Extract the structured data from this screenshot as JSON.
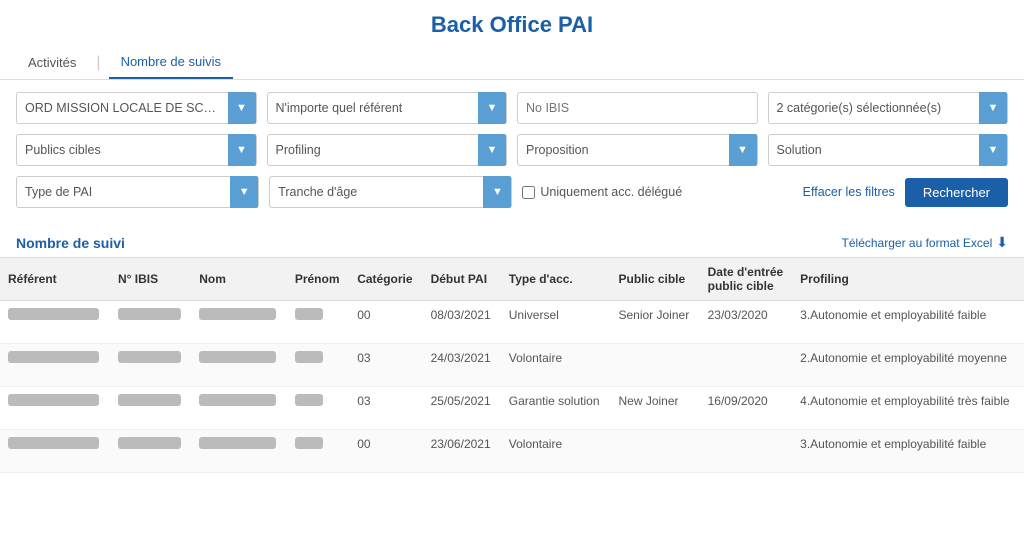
{
  "page": {
    "title": "Back Office PAI"
  },
  "tabs": [
    {
      "id": "activites",
      "label": "Activités",
      "active": false
    },
    {
      "id": "nombre-suivis",
      "label": "Nombre de suivis",
      "active": true
    }
  ],
  "filters": {
    "row1": [
      {
        "id": "mission-locale",
        "label": "ORD MISSION LOCALE DE SCHA...",
        "type": "select"
      },
      {
        "id": "referent",
        "label": "N'importe quel référent",
        "type": "select"
      },
      {
        "id": "ibis",
        "label": "No IBIS",
        "type": "input"
      },
      {
        "id": "categories",
        "label": "2 catégorie(s) sélectionnée(s)",
        "type": "select"
      }
    ],
    "row2": [
      {
        "id": "publics-cibles",
        "label": "Publics cibles",
        "type": "select"
      },
      {
        "id": "profiling",
        "label": "Profiling",
        "type": "select"
      },
      {
        "id": "proposition",
        "label": "Proposition",
        "type": "select"
      },
      {
        "id": "solution",
        "label": "Solution",
        "type": "select"
      }
    ],
    "row3": [
      {
        "id": "type-pai",
        "label": "Type de PAI",
        "type": "select"
      },
      {
        "id": "tranche-age",
        "label": "Tranche d'âge",
        "type": "select"
      },
      {
        "id": "uniquement-acc-delegue",
        "label": "Uniquement acc. délégué",
        "type": "checkbox"
      }
    ],
    "clear_label": "Effacer les filtres",
    "search_label": "Rechercher"
  },
  "section": {
    "title": "Nombre de suivi",
    "excel_label": "Télécharger au format Excel"
  },
  "table": {
    "columns": [
      {
        "id": "referent",
        "label": "Référent"
      },
      {
        "id": "ibis",
        "label": "N° IBIS"
      },
      {
        "id": "nom",
        "label": "Nom"
      },
      {
        "id": "prenom",
        "label": "Prénom"
      },
      {
        "id": "categorie",
        "label": "Catégorie"
      },
      {
        "id": "debut-pai",
        "label": "Début PAI"
      },
      {
        "id": "type-acc",
        "label": "Type d'acc."
      },
      {
        "id": "public-cible",
        "label": "Public cible"
      },
      {
        "id": "date-entree-public-cible",
        "label": "Date d'entrée public cible"
      },
      {
        "id": "profiling",
        "label": "Profiling"
      }
    ],
    "rows": [
      {
        "referent": "████ ████████",
        "ibis": "████ ████",
        "nom": "███████████",
        "prenom": "████",
        "categorie": "00",
        "debut_pai": "08/03/2021",
        "type_acc": "Universel",
        "public_cible": "Senior Joiner",
        "date_entree": "23/03/2020",
        "profiling": "3.Autonomie et employabilité faible"
      },
      {
        "referent": "████ ████████",
        "ibis": "████ ████",
        "nom": "███████████",
        "prenom": "████",
        "categorie": "03",
        "debut_pai": "24/03/2021",
        "type_acc": "Volontaire",
        "public_cible": "",
        "date_entree": "",
        "profiling": "2.Autonomie et employabilité moyenne"
      },
      {
        "referent": "████ ████████",
        "ibis": "████ ████",
        "nom": "███████████",
        "prenom": "████",
        "categorie": "03",
        "debut_pai": "25/05/2021",
        "type_acc": "Garantie solution",
        "public_cible": "New Joiner",
        "date_entree": "16/09/2020",
        "profiling": "4.Autonomie et employabilité très faible"
      },
      {
        "referent": "████ ████████",
        "ibis": "████ ████",
        "nom": "███████████",
        "prenom": "████",
        "categorie": "00",
        "debut_pai": "23/06/2021",
        "type_acc": "Volontaire",
        "public_cible": "",
        "date_entree": "",
        "profiling": "3.Autonomie et employabilité faible"
      }
    ]
  }
}
